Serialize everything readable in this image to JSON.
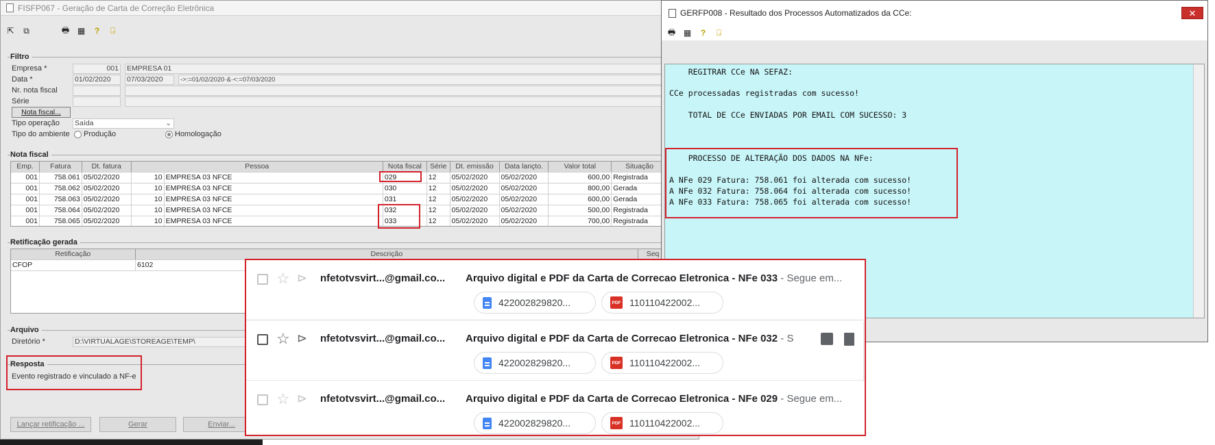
{
  "left_window": {
    "title": "FISFP067 - Geração de Carta de Correção Eletrônica",
    "toolbar_icons": [
      "export-icon",
      "copy-icon",
      "print-icon",
      "grid-icon",
      "help-icon",
      "exit-icon"
    ],
    "filtro": {
      "label": "Filtro",
      "empresa_label": "Empresa *",
      "empresa_code": "001",
      "empresa_name": "EMPRESA 01",
      "data_label": "Data *",
      "data_from": "01/02/2020",
      "data_to": "07/03/2020",
      "data_expr": "->:=01/02/2020·&·<:=07/03/2020",
      "nota_label": "Nr. nota fiscal",
      "serie_label": "Série",
      "nota_button": "Nota fiscal...",
      "tipo_op_label": "Tipo operação",
      "tipo_op_value": "Saída",
      "ambiente_label": "Tipo do ambiente",
      "ambiente_opt1": "Produção",
      "ambiente_opt2": "Homologação"
    },
    "nota_fiscal": {
      "label": "Nota fiscal",
      "columns": [
        "Emp.",
        "Fatura",
        "Dt. fatura",
        "Pessoa",
        "Nota fiscal",
        "Série",
        "Dt. emissão",
        "Data lançto.",
        "Valor total",
        "Situação"
      ],
      "rows": [
        {
          "emp": "001",
          "fatura": "758.061",
          "dt": "05/02/2020",
          "cod": "10",
          "pessoa": "EMPRESA 03 NFCE",
          "nota": "029",
          "serie": "12",
          "emissao": "05/02/2020",
          "lancto": "05/02/2020",
          "valor": "600,00",
          "situacao": "Registrada"
        },
        {
          "emp": "001",
          "fatura": "758.062",
          "dt": "05/02/2020",
          "cod": "10",
          "pessoa": "EMPRESA 03 NFCE",
          "nota": "030",
          "serie": "12",
          "emissao": "05/02/2020",
          "lancto": "05/02/2020",
          "valor": "800,00",
          "situacao": "Gerada"
        },
        {
          "emp": "001",
          "fatura": "758.063",
          "dt": "05/02/2020",
          "cod": "10",
          "pessoa": "EMPRESA 03 NFCE",
          "nota": "031",
          "serie": "12",
          "emissao": "05/02/2020",
          "lancto": "05/02/2020",
          "valor": "600,00",
          "situacao": "Gerada"
        },
        {
          "emp": "001",
          "fatura": "758.064",
          "dt": "05/02/2020",
          "cod": "10",
          "pessoa": "EMPRESA 03 NFCE",
          "nota": "032",
          "serie": "12",
          "emissao": "05/02/2020",
          "lancto": "05/02/2020",
          "valor": "500,00",
          "situacao": "Registrada"
        },
        {
          "emp": "001",
          "fatura": "758.065",
          "dt": "05/02/2020",
          "cod": "10",
          "pessoa": "EMPRESA 03 NFCE",
          "nota": "033",
          "serie": "12",
          "emissao": "05/02/2020",
          "lancto": "05/02/2020",
          "valor": "700,00",
          "situacao": "Registrada"
        }
      ]
    },
    "retificacao": {
      "label": "Retificação gerada",
      "col1": "Retificação",
      "col2": "Descrição",
      "col3": "Seq",
      "row_ret": "CFOP",
      "row_desc": "6102"
    },
    "arquivo": {
      "label": "Arquivo",
      "dir_label": "Diretório *",
      "dir_value": "D:\\VIRTUALAGE\\STOREAGE\\TEMP\\"
    },
    "resposta": {
      "label": "Resposta",
      "text": "Evento registrado e vinculado a NF-e"
    },
    "buttons": {
      "lancar": "Lançar retificação ...",
      "gerar": "Gerar",
      "enviar": "Enviar..."
    }
  },
  "right_window": {
    "title": "GERFP008 - Resultado dos Processos Automatizados da CCe:",
    "lines": [
      "    REGITRAR CCe NA SEFAZ:",
      "",
      "CCe processadas registradas com sucesso!",
      "",
      "    TOTAL DE CCe ENVIADAS POR EMAIL COM SUCESSO: 3",
      "",
      "",
      "",
      "    PROCESSO DE ALTERAÇÃO DOS DADOS NA NFe:",
      "",
      "A NFe 029 Fatura: 758.061 foi alterada com sucesso!",
      "A NFe 032 Fatura: 758.064 foi alterada com sucesso!",
      "A NFe 033 Fatura: 758.065 foi alterada com sucesso!"
    ]
  },
  "emails": [
    {
      "sender": "nfetotvsvirt...@gmail.co...",
      "subject": "Arquivo digital e PDF da Carta de Correcao Eletronica - NFe 033",
      "snippet": " - Segue em...",
      "att1": "422002829820...",
      "att2": "110110422002..."
    },
    {
      "sender": "nfetotvsvirt...@gmail.co...",
      "subject": "Arquivo digital e PDF da Carta de Correcao Eletronica - NFe 032",
      "snippet": " - S",
      "att1": "422002829820...",
      "att2": "110110422002..."
    },
    {
      "sender": "nfetotvsvirt...@gmail.co...",
      "subject": "Arquivo digital e PDF da Carta de Correcao Eletronica - NFe 029",
      "snippet": " - Segue em...",
      "att1": "422002829820...",
      "att2": "110110422002..."
    }
  ],
  "pdf_label": "PDF",
  "colors": {
    "highlight": "#d3202a",
    "result_bg": "#c8f5f8",
    "window_bg": "#e8e8e8"
  }
}
